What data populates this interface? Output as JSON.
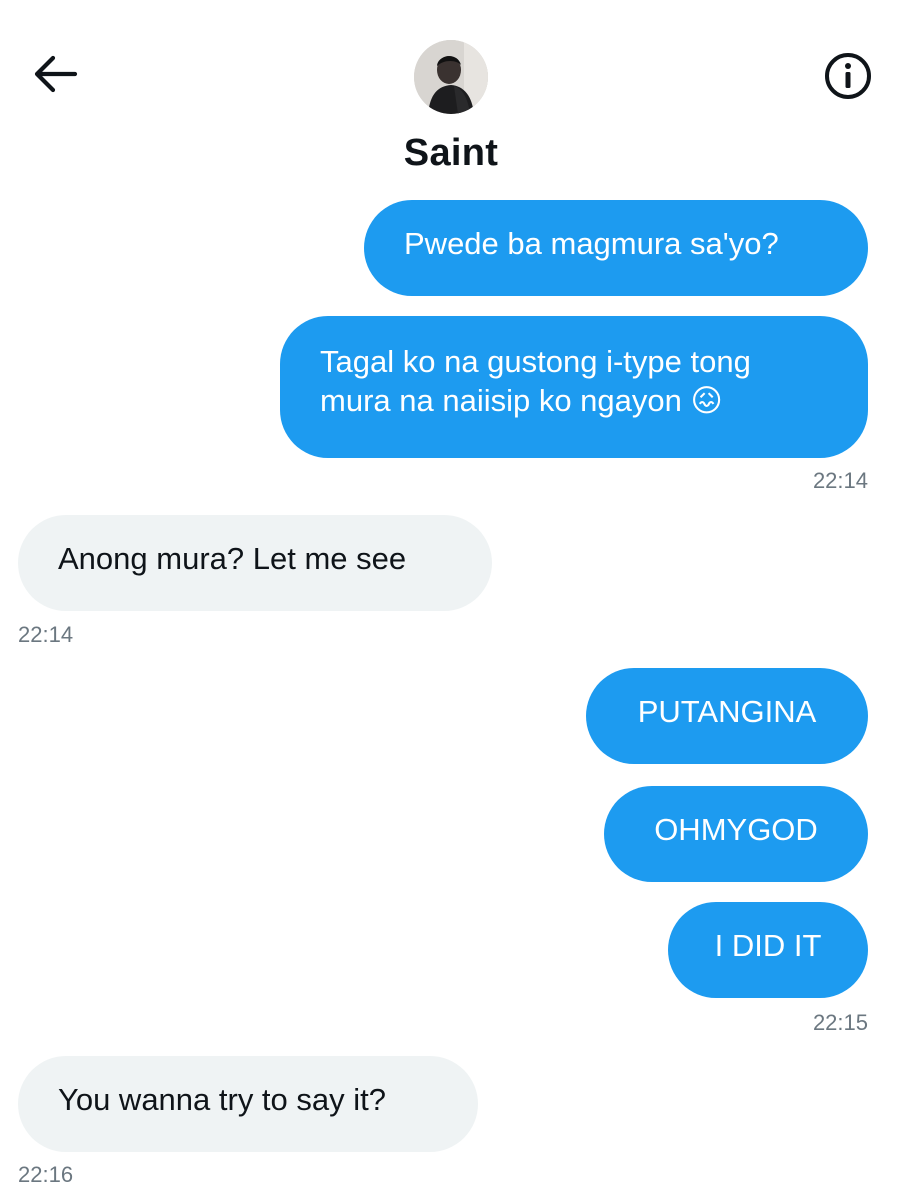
{
  "header": {
    "contact_name": "Saint",
    "back_icon": "back-arrow-icon",
    "info_icon": "info-icon"
  },
  "messages": [
    {
      "direction": "sent",
      "text": "Pwede ba magmura sa'yo?"
    },
    {
      "direction": "sent",
      "lines": [
        "Tagal ko na gustong i-type tong",
        "mura na naiisip ko ngayon 😖"
      ],
      "time": "22:14"
    },
    {
      "direction": "received",
      "text": "Anong mura? Let me see",
      "time": "22:14"
    },
    {
      "direction": "sent",
      "text": "PUTANGINA"
    },
    {
      "direction": "sent",
      "text": "OHMYGOD"
    },
    {
      "direction": "sent",
      "text": "I DID IT",
      "time": "22:15"
    },
    {
      "direction": "received",
      "text": "You wanna try to say it?",
      "time": "22:16"
    }
  ],
  "colors": {
    "sent_bubble": "#1d9bf0",
    "received_bubble": "#eff3f4",
    "timestamp": "#6b7780"
  }
}
